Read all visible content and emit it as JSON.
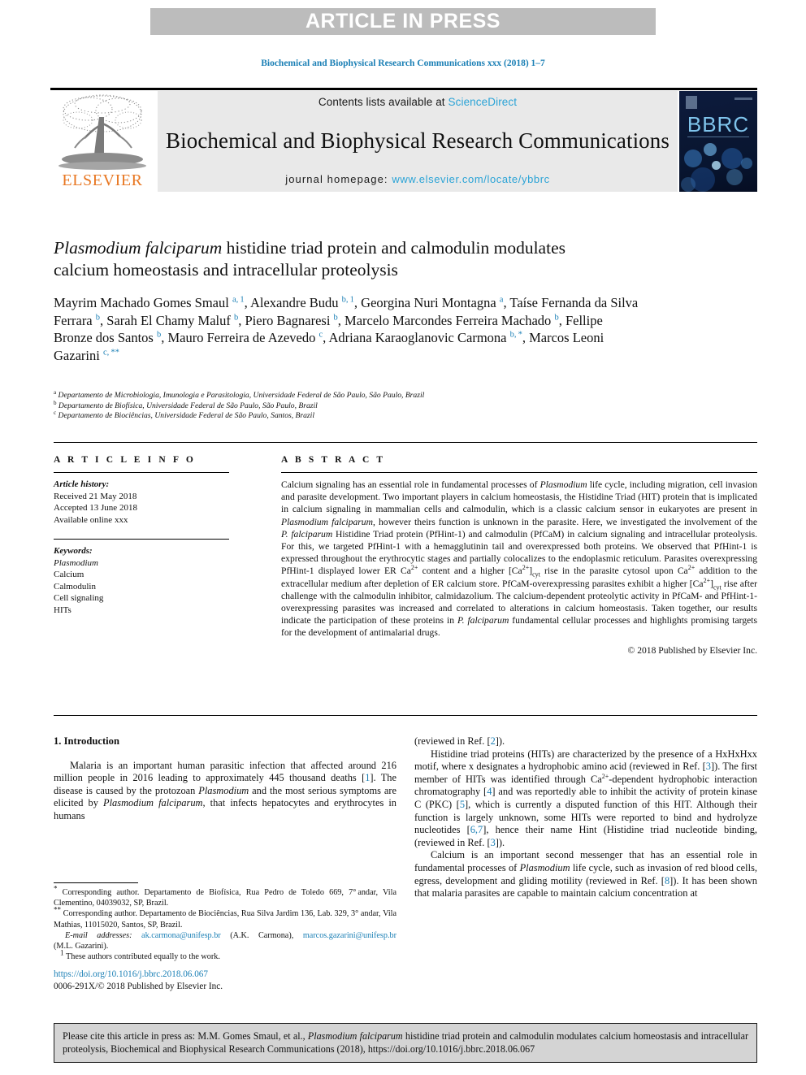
{
  "banner": {
    "label": "ARTICLE IN PRESS"
  },
  "running_head": "Biochemical and Biophysical Research Communications xxx (2018) 1–7",
  "masthead": {
    "contents_prefix": "Contents lists available at ",
    "sciencedirect": "ScienceDirect",
    "journal_title": "Biochemical and Biophysical Research Communications",
    "homepage_prefix": "journal homepage: ",
    "homepage_url": "www.elsevier.com/locate/ybbrc",
    "elsevier_wordmark": "ELSEVIER",
    "cover_wordmark": "BBRC",
    "accent_blue": "#2aa3d6",
    "elsevier_orange": "#e87722",
    "banner_grey": "#bcbcbc"
  },
  "title": {
    "part_italic": "Plasmodium falciparum",
    "part_rest": " histidine triad protein and calmodulin modulates calcium homeostasis and intracellular proteolysis"
  },
  "authors_html": "Mayrim Machado Gomes Smaul <sup>a,&#8201;1</sup>, Alexandre Budu <sup>b,&#8201;1</sup>, Georgina Nuri Montagna <sup>a</sup>, Taíse Fernanda da Silva Ferrara <sup>b</sup>, Sarah El Chamy Maluf <sup>b</sup>, Piero Bagnaresi <sup>b</sup>, Marcelo Marcondes Ferreira Machado <sup>b</sup>, Fellipe Bronze dos Santos <sup>b</sup>, Mauro Ferreira de Azevedo <sup>c</sup>, Adriana Karaoglanovic Carmona <sup>b,&#8201;*</sup>, Marcos Leoni Gazarini <sup>c,&#8201;**</sup>",
  "affiliations": [
    {
      "mark": "a",
      "text": "Departamento de Microbiologia, Imunologia e Parasitologia, Universidade Federal de São Paulo, São Paulo, Brazil"
    },
    {
      "mark": "b",
      "text": "Departamento de Biofísica, Universidade Federal de São Paulo, São Paulo, Brazil"
    },
    {
      "mark": "c",
      "text": "Departamento de Biociências, Universidade Federal de São Paulo, Santos, Brazil"
    }
  ],
  "article_info": {
    "heading": "A R T I C L E   I N F O",
    "history_label": "Article history:",
    "history": [
      "Received 21 May 2018",
      "Accepted 13 June 2018",
      "Available online xxx"
    ],
    "keywords_label": "Keywords:",
    "keywords": [
      "Plasmodium",
      "Calcium",
      "Calmodulin",
      "Cell signaling",
      "HITs"
    ]
  },
  "abstract": {
    "heading": "A B S T R A C T",
    "body_html": "Calcium signaling has an essential role in fundamental processes of <i>Plasmodium</i> life cycle, including migration, cell invasion and parasite development. Two important players in calcium homeostasis, the Histidine Triad (HIT) protein that is implicated in calcium signaling in mammalian cells and calmodulin, which is a classic calcium sensor in eukaryotes are present in <i>Plasmodium falciparum</i>, however theirs function is unknown in the parasite. Here, we investigated the involvement of the <i>P.&nbsp;falciparum</i> Histidine Triad protein (PfHint-1) and calmodulin (PfCaM) in calcium signaling and intracellular proteolysis. For this, we targeted PfHint-1 with a hemagglutinin tail and overexpressed both proteins. We observed that PfHint-1 is expressed throughout the erythrocytic stages and partially colocalizes to the endoplasmic reticulum. Parasites overexpressing PfHint-1 displayed lower ER Ca<sup class=\"sm\">2+</sup> content and a higher [Ca<sup class=\"sm\">2+</sup>]<sub class=\"sm\">cyt</sub> rise in the parasite cytosol upon Ca<sup class=\"sm\">2+</sup> addition to the extracellular medium after depletion of ER calcium store. PfCaM-overexpressing parasites exhibit a higher [Ca<sup class=\"sm\">2+</sup>]<sub class=\"sm\">cyt</sub> rise after challenge with the calmodulin inhibitor, calmidazolium. The calcium-dependent proteolytic activity in PfCaM- and PfHint-1-overexpressing parasites was increased and correlated to alterations in calcium homeostasis. Taken together, our results indicate the participation of these proteins in <i>P.&nbsp;falciparum</i> fundamental cellular processes and highlights promising targets for the development of antimalarial drugs.",
    "copyright": "© 2018 Published by Elsevier Inc."
  },
  "body": {
    "section_number_title": "1.  Introduction",
    "left_paragraph_html": "Malaria is an important human parasitic infection that affected around 216 million people in 2016 leading to approximately 445 thousand deaths [<span class=\"ref\">1</span>]. The disease is caused by the protozoan <i>Plasmodium</i> and the most serious symptoms are elicited by <i>Plasmodium falciparum</i>, that infects hepatocytes and erythrocytes in humans",
    "right_paragraphs_html": [
      "(reviewed in Ref.&nbsp;[<span class=\"ref\">2</span>]).",
      "Histidine triad proteins (HITs) are characterized by the presence of a HxHxHxx motif, where x designates a hydrophobic amino acid (reviewed in Ref.&nbsp;[<span class=\"ref\">3</span>]). The first member of HITs was identified through Ca<sup class=\"sm\">2+</sup>-dependent hydrophobic interaction chromatography [<span class=\"ref\">4</span>] and was reportedly able to inhibit the activity of protein kinase C (PKC) [<span class=\"ref\">5</span>], which is currently a disputed function of this HIT. Although their function is largely unknown, some HITs were reported to bind and hydrolyze nucleotides [<span class=\"ref\">6,7</span>], hence their name Hint (Histidine triad nucleotide binding, (reviewed in Ref.&nbsp;[<span class=\"ref\">3</span>]).",
      "Calcium is an important second messenger that has an essential role in fundamental processes of <i>Plasmodium</i> life cycle, such as invasion of red blood cells, egress, development and gliding motility (reviewed in Ref.&nbsp;[<span class=\"ref\">8</span>]). It has been shown that malaria parasites are capable to maintain calcium concentration at"
    ]
  },
  "footnotes_html": [
    "<span class=\"fn-mark\">*</span>&nbsp;Corresponding author. Departamento de Biofísica, Rua Pedro de Toledo 669, 7°&#8201;andar, Vila Clementino, 04039032, SP, Brazil.",
    "<span class=\"fn-mark\">**</span>&nbsp;Corresponding author. Departamento de Biociências, Rua Silva Jardim 136, Lab. 329, 3° andar, Vila Mathias, 11015020, Santos, SP, Brazil.",
    "<span class=\"lbl\">E-mail addresses:</span> <span class=\"link\">ak.carmona@unifesp.br</span> (A.K.&nbsp;Carmona), <span class=\"link\">marcos.gazarini@unifesp.br</span> (M.L.&nbsp;Gazarini).",
    "<span class=\"fn-mark\">1</span>&nbsp;These authors contributed equally to the work."
  ],
  "doi_block": {
    "doi": "https://doi.org/10.1016/j.bbrc.2018.06.067",
    "issn_line": "0006-291X/© 2018 Published by Elsevier Inc."
  },
  "cite_box": {
    "html": "Please cite this article in press as: M.M. Gomes Smaul, et al., <i>Plasmodium falciparum</i> histidine triad protein and calmodulin modulates calcium homeostasis and intracellular proteolysis, Biochemical and Biophysical Research Communications (2018), https://doi.org/10.1016/j.bbrc.2018.06.067"
  }
}
